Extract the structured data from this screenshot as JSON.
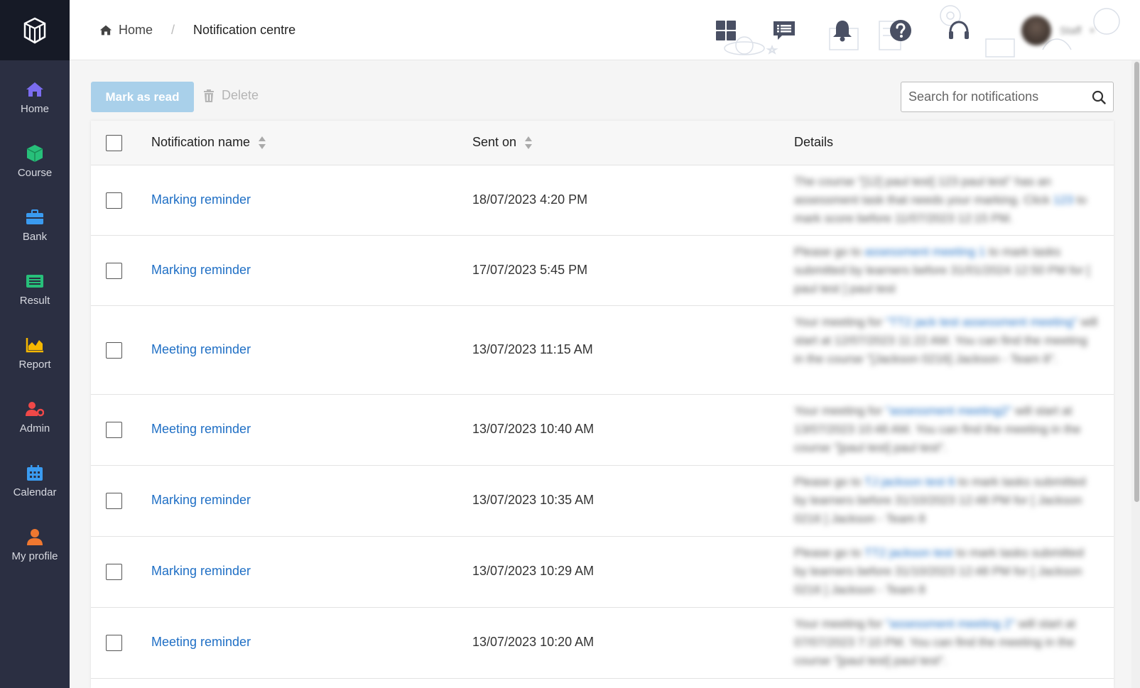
{
  "sidebar": {
    "items": [
      {
        "label": "Home",
        "icon": "home-icon",
        "color": "#7b6cf0"
      },
      {
        "label": "Course",
        "icon": "cube-icon",
        "color": "#27c07a"
      },
      {
        "label": "Bank",
        "icon": "briefcase-icon",
        "color": "#3a9bf0"
      },
      {
        "label": "Result",
        "icon": "list-icon",
        "color": "#27c07a"
      },
      {
        "label": "Report",
        "icon": "chart-icon",
        "color": "#f5b800"
      },
      {
        "label": "Admin",
        "icon": "user-gear-icon",
        "color": "#f04848"
      },
      {
        "label": "Calendar",
        "icon": "calendar-icon",
        "color": "#3a9bf0"
      },
      {
        "label": "My profile",
        "icon": "user-icon",
        "color": "#f07830"
      }
    ]
  },
  "header": {
    "breadcrumb_home": "Home",
    "breadcrumb_separator": "/",
    "breadcrumb_current": "Notification centre",
    "icons": [
      "grid-icon",
      "message-list-icon",
      "bell-icon",
      "help-icon",
      "headset-icon"
    ],
    "user_name": "Staff"
  },
  "toolbar": {
    "mark_as_read": "Mark as read",
    "delete": "Delete",
    "search_placeholder": "Search for notifications"
  },
  "table": {
    "columns": [
      "Notification name",
      "Sent on",
      "Details"
    ],
    "rows": [
      {
        "name": "Marking reminder",
        "sent_on": "18/07/2023 4:20 PM",
        "details_pre": "The course \"[12] paul test] 123 paul test\" has an assessment task that needs your marking. Click",
        "details_link": "123",
        "details_post": "to mark score before 11/07/2023 12:15 PM."
      },
      {
        "name": "Marking reminder",
        "sent_on": "17/07/2023 5:45 PM",
        "details_pre": "Please go to",
        "details_link": "assessment meeting 1",
        "details_post": "to mark tasks submitted by learners before 31/01/2024 12:50 PM for [ paul test ] paul test"
      },
      {
        "name": "Meeting reminder",
        "sent_on": "13/07/2023 11:15 AM",
        "details_pre": "Your meeting for",
        "details_link": "\"TT2 jack test assessment meeting\"",
        "details_post": "will start at 12/07/2023 11:22 AM. You can find the meeting in the course \"[Jackson 0216] Jackson - Team 8\"."
      },
      {
        "name": "Meeting reminder",
        "sent_on": "13/07/2023 10:40 AM",
        "details_pre": "Your meeting for",
        "details_link": "\"assessment meeting2\"",
        "details_post": "will start at 13/07/2023 10:48 AM. You can find the meeting in the course \"[paul test] paul test\"."
      },
      {
        "name": "Marking reminder",
        "sent_on": "13/07/2023 10:35 AM",
        "details_pre": "Please go to",
        "details_link": "TJ jackson test 6",
        "details_post": "to mark tasks submitted by learners before 31/10/2023 12:48 PM for [ Jackson 0216 ] Jackson - Team 8"
      },
      {
        "name": "Marking reminder",
        "sent_on": "13/07/2023 10:29 AM",
        "details_pre": "Please go to",
        "details_link": "TT2 jackson test",
        "details_post": "to mark tasks submitted by learners before 31/10/2023 12:48 PM for [ Jackson 0216 ] Jackson - Team 8"
      },
      {
        "name": "Meeting reminder",
        "sent_on": "13/07/2023 10:20 AM",
        "details_pre": "Your meeting for",
        "details_link": "\"assessment meeting 2\"",
        "details_post": "will start at 07/07/2023 7:10 PM. You can find the meeting in the course \"[paul test] paul test\"."
      }
    ]
  },
  "colors": {
    "sidebar_bg": "#2b2f42",
    "logo_bg": "#161a26",
    "link_blue": "#1f6fc5",
    "button_disabled": "#a9d0ea",
    "header_icon": "#4a5064"
  }
}
